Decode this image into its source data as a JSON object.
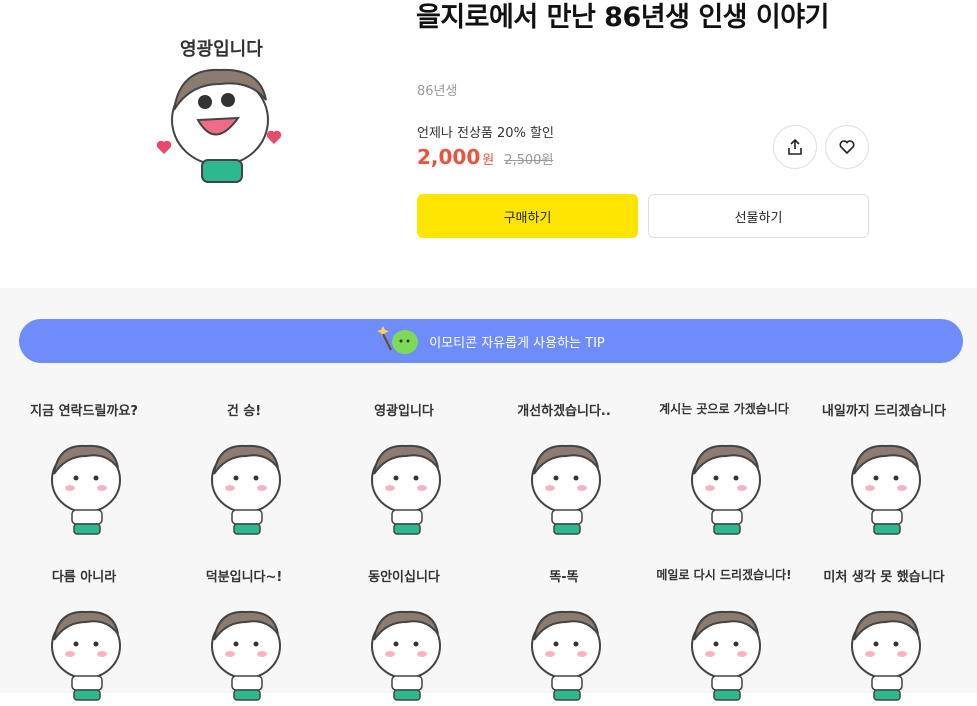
{
  "product": {
    "title": "을지로에서 만난 86년생 인생 이야기",
    "author": "86년생",
    "hero_caption": "영광입니다"
  },
  "pricing": {
    "promo_text": "언제나 전상품 20% 할인",
    "price": "2,000",
    "price_unit": "원",
    "original_price": "2,500원"
  },
  "actions": {
    "buy_label": "구매하기",
    "gift_label": "선물하기"
  },
  "tip_bar": {
    "label": "이모티콘 자유롭게 사용하는 TIP"
  },
  "emoticons": [
    {
      "caption": "지금 연락드릴까요?"
    },
    {
      "caption": "건 승!"
    },
    {
      "caption": "영광입니다"
    },
    {
      "caption": "개선하겠습니다.."
    },
    {
      "caption": "계시는 곳으로 가겠습니다"
    },
    {
      "caption": "내일까지 드리겠습니다"
    },
    {
      "caption": "다름 아니라"
    },
    {
      "caption": "덕분입니다~!"
    },
    {
      "caption": "동안이십니다"
    },
    {
      "caption": "똑-똑"
    },
    {
      "caption": "메일로 다시 드리겠습니다!"
    },
    {
      "caption": "미처 생각 못 했습니다"
    }
  ],
  "colors": {
    "buy_button": "#fee500",
    "price": "#f0513a",
    "tip_bar": "#6e8dfb",
    "gallery_bg": "#f7f7f7"
  }
}
